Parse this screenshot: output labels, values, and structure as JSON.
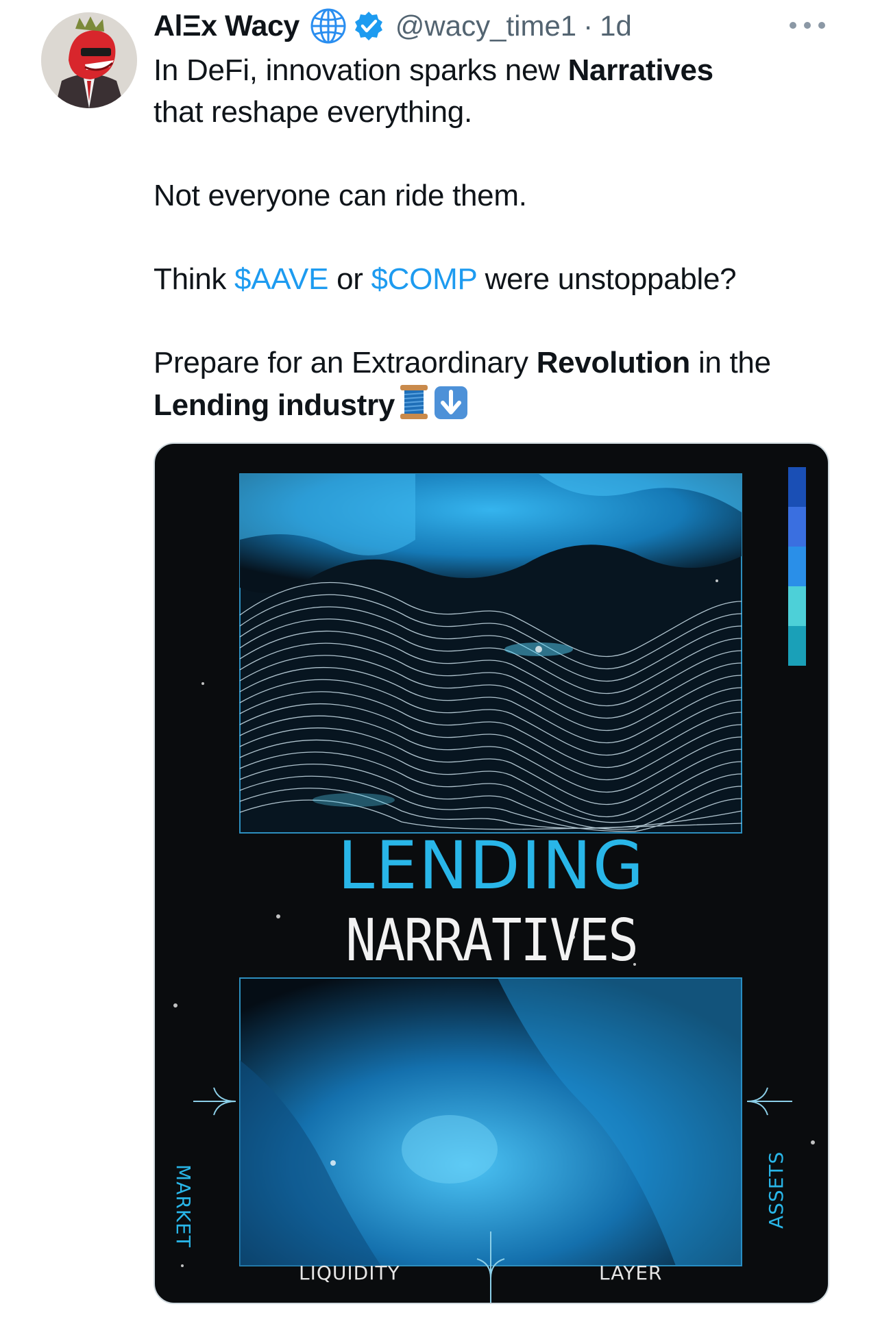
{
  "tweet": {
    "author": {
      "display_name": "AlΞx Wacy",
      "handle": "@wacy_time1",
      "separator": "·",
      "time": "1d",
      "avatar_icon": "red-dragon-avatar",
      "badge_icons": [
        "globe-icon",
        "verified-badge-icon"
      ],
      "verified_color": "#1d9bf0"
    },
    "more_icon": "more-horizontal-icon",
    "text": {
      "line1_a": "In DeFi, innovation sparks new ",
      "line1_b": "Narratives",
      "line1_c": " that reshape everything.",
      "line2": "Not everyone can ride them.",
      "line3_a": "Think ",
      "line3_cashtag1": "$AAVE",
      "line3_b": " or ",
      "line3_cashtag2": "$COMP",
      "line3_c": " were unstoppable?",
      "line4_a": "Prepare for an Extraordinary ",
      "line4_b": "Revolution",
      "line4_c": " in the ",
      "line4_d": "Lending industry",
      "emojis": [
        "spool-of-thread-icon",
        "down-arrow-icon"
      ]
    },
    "cashtag_color": "#1d9bf0",
    "media": {
      "title": "LENDING",
      "subtitle": "NARRATIVES",
      "labels": {
        "left": "MARKET",
        "bottom_left": "LIQUIDITY",
        "bottom_right": "LAYER",
        "right": "ASSETS"
      },
      "accent_color": "#29b6e8",
      "swatches": [
        "#1a4fb5",
        "#3a6fe0",
        "#2a8fe8",
        "#4dd0d8",
        "#1aa0b8"
      ]
    }
  }
}
